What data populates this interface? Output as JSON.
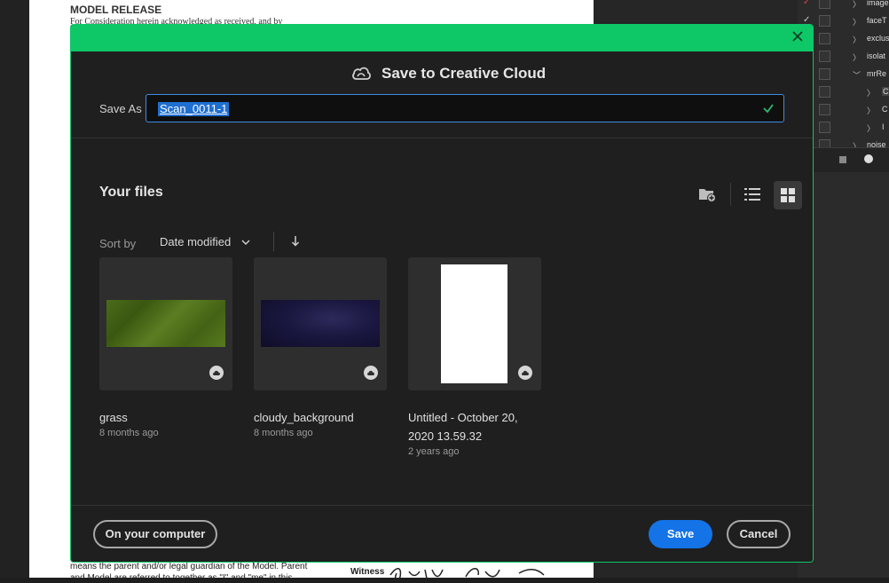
{
  "background_document": {
    "title": "MODEL RELEASE",
    "line1": "For Consideration herein acknowledged as received, and by",
    "bottom_line1": "means the parent and/or legal guardian of the Model. Parent",
    "bottom_line2": "and Model are referred to together as \"I\" and \"me\" in this",
    "witness_label": "Witness"
  },
  "layers_panel": {
    "rows": [
      {
        "label": "image"
      },
      {
        "label": "faceT"
      },
      {
        "label": "exclus"
      },
      {
        "label": "isolat"
      },
      {
        "label": "mrRe"
      },
      {
        "label": "C"
      },
      {
        "label": "C"
      },
      {
        "label": "I"
      },
      {
        "label": "noise"
      }
    ]
  },
  "dialog": {
    "title": "Save to Creative Cloud",
    "save_as_label": "Save As",
    "save_as_value": "Scan_0011-1",
    "files_title": "Your files",
    "sort_by_label": "Sort by",
    "sort_value": "Date modified",
    "files": [
      {
        "name": "grass",
        "date": "8 months ago"
      },
      {
        "name": "cloudy_background",
        "date": "8 months ago"
      },
      {
        "name": "Untitled - October 20, 2020 13.59.32",
        "date": "2 years ago"
      }
    ],
    "on_computer_label": "On your computer",
    "save_label": "Save",
    "cancel_label": "Cancel"
  },
  "colors": {
    "title_bar": "#0ec868",
    "primary_button": "#1473e6",
    "selection": "#1f6fd1"
  }
}
